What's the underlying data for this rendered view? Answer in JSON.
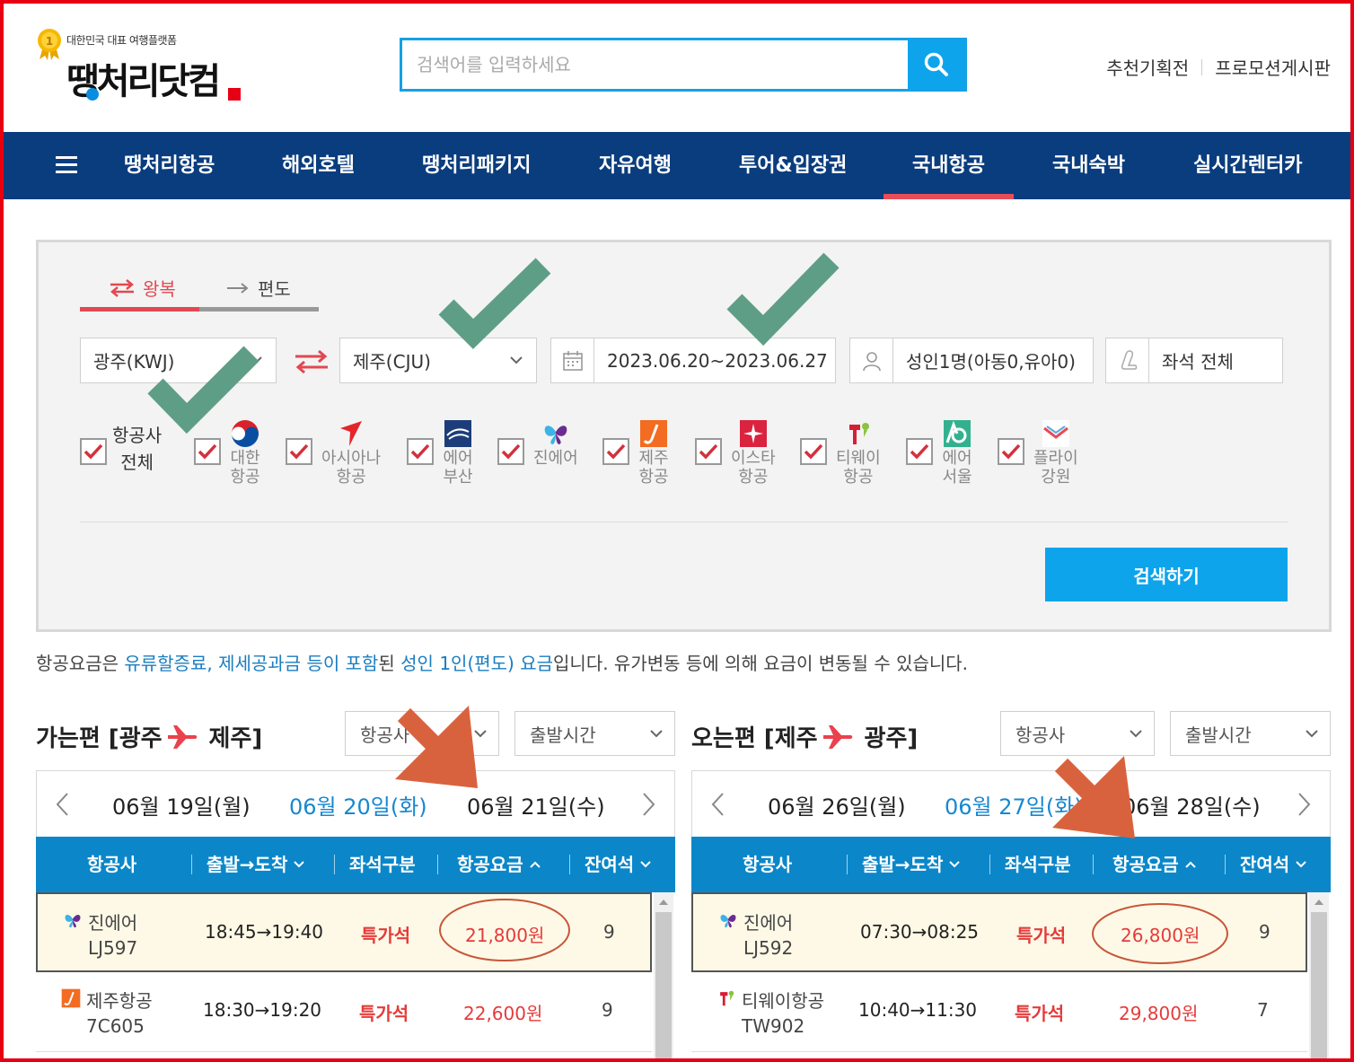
{
  "header": {
    "logo_sub": "대한민국 대표 여행플랫폼",
    "logo_main": "땡처리닷컴",
    "search_placeholder": "검색어를 입력하세요",
    "links": [
      "추천기획전",
      "프로모션게시판"
    ]
  },
  "nav": {
    "items": [
      "땡처리항공",
      "해외호텔",
      "땡처리패키지",
      "자유여행",
      "투어&입장권",
      "국내항공",
      "국내숙박",
      "실시간렌터카"
    ],
    "active": "국내항공"
  },
  "search": {
    "tab_round": "왕복",
    "tab_oneway": "편도",
    "origin": "광주(KWJ)",
    "destination": "제주(CJU)",
    "dates": "2023.06.20~2023.06.27",
    "passengers": "성인1명(아동0,유아0)",
    "seat_class": "좌석 전체",
    "all_airlines_line1": "항공사",
    "all_airlines_line2": "전체",
    "airlines": [
      {
        "line1": "대한",
        "line2": "항공"
      },
      {
        "line1": "아시아나",
        "line2": "항공"
      },
      {
        "line1": "에어",
        "line2": "부산"
      },
      {
        "line1": "진에어",
        "line2": ""
      },
      {
        "line1": "제주",
        "line2": "항공"
      },
      {
        "line1": "이스타",
        "line2": "항공"
      },
      {
        "line1": "티웨이",
        "line2": "항공"
      },
      {
        "line1": "에어",
        "line2": "서울"
      },
      {
        "line1": "플라이",
        "line2": "강원"
      }
    ],
    "submit": "검색하기"
  },
  "notice": {
    "p1": "항공요금은 ",
    "hl1": "유류할증료, 제세공과금 등이 포함",
    "p2": "된 ",
    "hl2": "성인 1인(편도) 요금",
    "p3": "입니다. 유가변동 등에 의해 요금이 변동될 수 있습니다."
  },
  "outbound": {
    "title_prefix": "가는편 [광주",
    "title_suffix": "제주]",
    "filter_airline": "항공사",
    "filter_time": "출발시간",
    "dates": [
      "06월 19일(월)",
      "06월 20일(화)",
      "06월 21일(수)"
    ],
    "selected_date": "06월 20일(화)",
    "columns": [
      "항공사",
      "출발→도착",
      "좌석구분",
      "항공요금",
      "잔여석"
    ],
    "rows": [
      {
        "airline": "진에어",
        "flight": "LJ597",
        "time": "18:45→19:40",
        "seat": "특가석",
        "price": "21,800원",
        "left": "9"
      },
      {
        "airline": "제주항공",
        "flight": "7C605",
        "time": "18:30→19:20",
        "seat": "특가석",
        "price": "22,600원",
        "left": "9"
      }
    ]
  },
  "inbound": {
    "title_prefix": "오는편 [제주",
    "title_suffix": "광주]",
    "filter_airline": "항공사",
    "filter_time": "출발시간",
    "dates": [
      "06월 26일(월)",
      "06월 27일(화)",
      "06월 28일(수)"
    ],
    "selected_date": "06월 27일(화)",
    "columns": [
      "항공사",
      "출발→도착",
      "좌석구분",
      "항공요금",
      "잔여석"
    ],
    "rows": [
      {
        "airline": "진에어",
        "flight": "LJ592",
        "time": "07:30→08:25",
        "seat": "특가석",
        "price": "26,800원",
        "left": "9"
      },
      {
        "airline": "티웨이항공",
        "flight": "TW902",
        "time": "10:40→11:30",
        "seat": "특가석",
        "price": "29,800원",
        "left": "7"
      }
    ]
  },
  "colors": {
    "nav_bg": "#0a3d7e",
    "accent_blue": "#0da4ec",
    "table_header": "#0b87c9",
    "price_red": "#e53b3b",
    "frame_red": "#e60012",
    "annotation_check": "#5f9e86",
    "annotation_arrow": "#d9623e"
  }
}
